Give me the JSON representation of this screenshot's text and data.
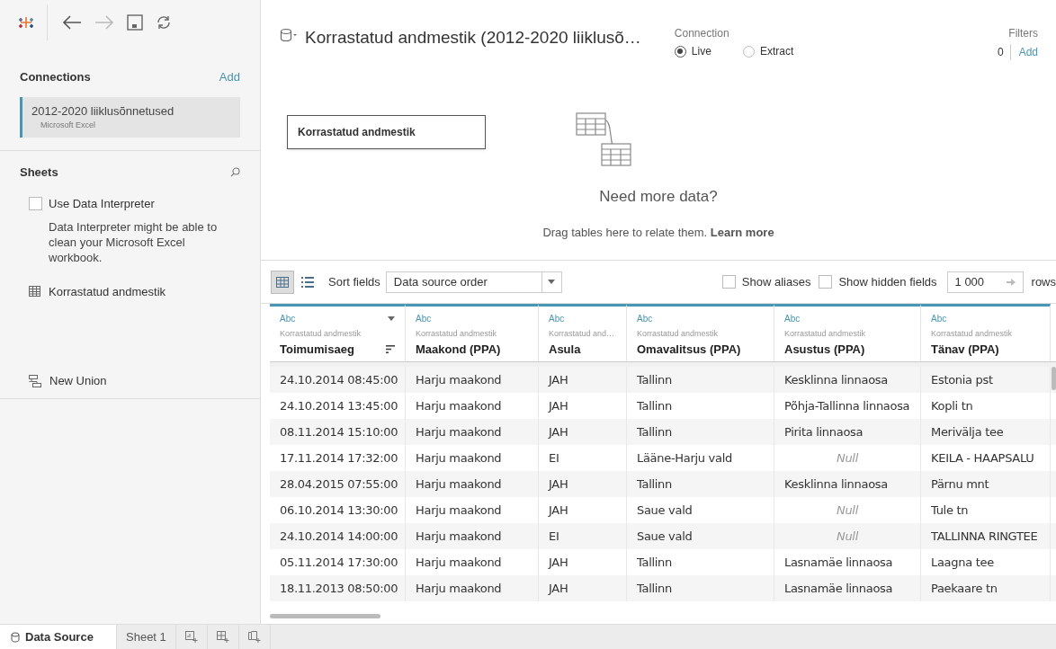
{
  "connections": {
    "title": "Connections",
    "add": "Add",
    "items": [
      {
        "name": "2012-2020 liiklusõnnetused",
        "type": "Microsoft Excel",
        "selected": true
      }
    ]
  },
  "sheets": {
    "title": "Sheets",
    "interpreter": {
      "label": "Use Data Interpreter",
      "checked": false,
      "hint": "Data Interpreter might be able to clean your Microsoft Excel workbook."
    },
    "items": [
      {
        "kind": "table",
        "label": "Korrastatud andmestik"
      },
      {
        "kind": "union",
        "label": "New Union"
      }
    ]
  },
  "datasource": {
    "title": "Korrastatud andmestik (2012-2020 liiklusõ…",
    "connection_label": "Connection",
    "connection_options": [
      {
        "label": "Live",
        "selected": true
      },
      {
        "label": "Extract",
        "selected": false
      }
    ],
    "filters_label": "Filters",
    "filters_count": "0",
    "filters_add": "Add"
  },
  "canvas": {
    "table": "Korrastatud andmestik",
    "heading": "Need more data?",
    "hint": "Drag tables here to relate them. **Learn more**"
  },
  "grid_toolbar": {
    "views": [
      {
        "kind": "grid",
        "selected": true
      },
      {
        "kind": "list",
        "selected": false
      }
    ],
    "sort_label": "Sort fields",
    "sort_value": "Data source order",
    "show_aliases": {
      "label": "Show aliases",
      "checked": false
    },
    "show_hidden": {
      "label": "Show hidden fields",
      "checked": false
    },
    "rows_value": "1 000",
    "rows_label": "rows"
  },
  "table": {
    "columns": [
      {
        "type": "Abc",
        "source": "Korrastatud andmestik",
        "name": "Toimumisaeg",
        "menu": true
      },
      {
        "type": "Abc",
        "source": "Korrastatud andmestik",
        "name": "Maakond (PPA)",
        "menu": false
      },
      {
        "type": "Abc",
        "source": "Korrastatud and…",
        "name": "Asula",
        "menu": false
      },
      {
        "type": "Abc",
        "source": "Korrastatud andmestik",
        "name": "Omavalitsus (PPA)",
        "menu": false
      },
      {
        "type": "Abc",
        "source": "Korrastatud andmestik",
        "name": "Asustus (PPA)",
        "menu": false
      },
      {
        "type": "Abc",
        "source": "Korrastatud andmestik",
        "name": "Tänav (PPA)",
        "menu": false
      }
    ],
    "rows": [
      [
        "24.10.2014 08:45:00",
        "Harju maakond",
        "JAH",
        "Tallinn",
        "Kesklinna linnaosa",
        "Estonia pst"
      ],
      [
        "24.10.2014 13:45:00",
        "Harju maakond",
        "JAH",
        "Tallinn",
        "Põhja-Tallinna linnaosa",
        "Kopli tn"
      ],
      [
        "08.11.2014 15:10:00",
        "Harju maakond",
        "JAH",
        "Tallinn",
        "Pirita linnaosa",
        "Merivälja tee"
      ],
      [
        "17.11.2014 17:32:00",
        "Harju maakond",
        "EI",
        "Lääne-Harju vald",
        {
          "kind": "null",
          "text": "Null"
        },
        "KEILA - HAAPSALU"
      ],
      [
        "28.04.2015 07:55:00",
        "Harju maakond",
        "JAH",
        "Tallinn",
        "Kesklinna linnaosa",
        "Pärnu mnt"
      ],
      [
        "06.10.2014 13:30:00",
        "Harju maakond",
        "JAH",
        "Saue vald",
        {
          "kind": "null",
          "text": "Null"
        },
        "Tule tn"
      ],
      [
        "24.10.2014 14:00:00",
        "Harju maakond",
        "EI",
        "Saue vald",
        {
          "kind": "null",
          "text": "Null"
        },
        "TALLINNA  RINGTEE"
      ],
      [
        "05.11.2014 17:30:00",
        "Harju maakond",
        "JAH",
        "Tallinn",
        "Lasnamäe linnaosa",
        "Laagna tee"
      ],
      [
        "18.11.2013 08:50:00",
        "Harju maakond",
        "JAH",
        "Tallinn",
        "Lasnamäe linnaosa",
        "Paekaare tn"
      ]
    ]
  },
  "bottom_tabs": [
    {
      "kind": "datasource",
      "label": "Data Source",
      "selected": true
    },
    {
      "kind": "sheet",
      "label": "Sheet 1",
      "selected": false
    },
    {
      "kind": "new-sheet",
      "selected": false
    },
    {
      "kind": "new-dashboard",
      "selected": false
    },
    {
      "kind": "new-story",
      "selected": false
    }
  ]
}
